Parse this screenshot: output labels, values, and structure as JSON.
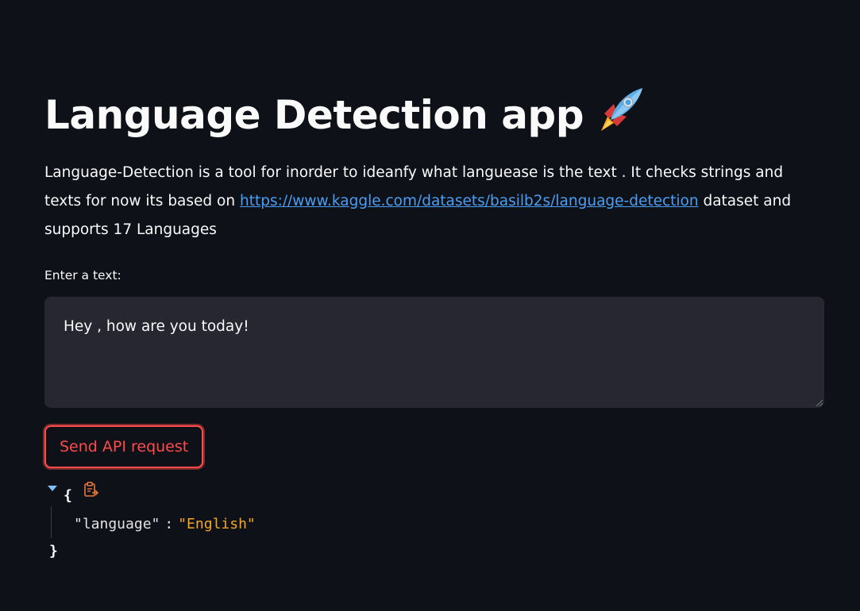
{
  "app": {
    "title": "Language Detection app",
    "title_icon": "rocket-emoji-icon",
    "description_prefix": "Language-Detection is a tool for inorder to ideanfy what languease is the text . It checks strings and texts for now its based on ",
    "description_link": "https://www.kaggle.com/datasets/basilb2s/language-detection",
    "description_suffix": " dataset and supports 17 Languages"
  },
  "input": {
    "label": "Enter a text:",
    "value": "Hey , how are you today!"
  },
  "actions": {
    "send_label": "Send API request"
  },
  "response": {
    "brace_open": "{",
    "key": "\"language\"",
    "colon": ":",
    "value": "\"English\"",
    "brace_close": "}"
  },
  "colors": {
    "background": "#0e1117",
    "input_background": "#262730",
    "accent": "#ff4b4b",
    "link": "#4a9ff5",
    "json_value": "#f5a623"
  }
}
